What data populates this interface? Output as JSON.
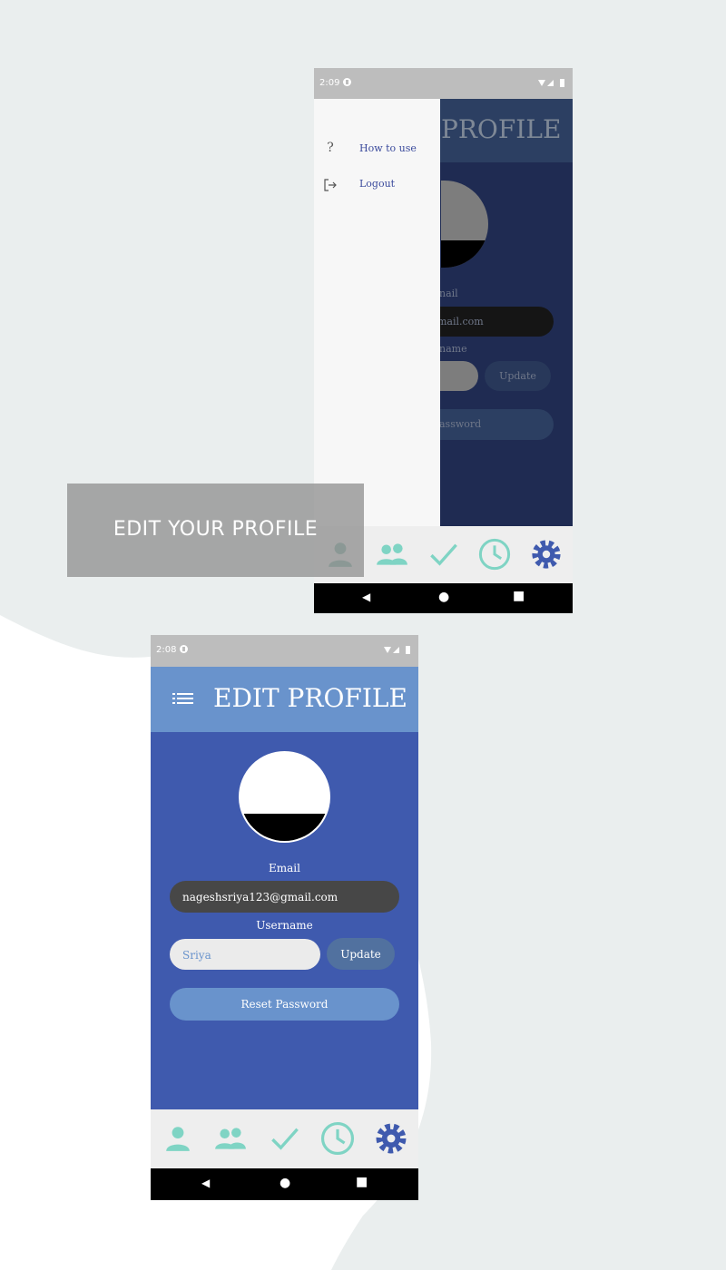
{
  "caption": "EDIT YOUR PROFILE",
  "colors": {
    "background": "#eaeeee",
    "app_bar": "#6993cc",
    "app_body": "#3f5aae",
    "email_pill": "#474747",
    "update_button": "#51719f",
    "reset_button": "#6993cc",
    "nav_icon_teal": "#7fd4c4",
    "nav_icon_active": "#3f5aae"
  },
  "screen_back": {
    "status": {
      "time": "2:09"
    },
    "title_partial": "PROFILE",
    "email_label_partial": "nail",
    "email_value_partial": "mail.com",
    "username_label_partial": "name",
    "update_label": "Update",
    "reset_partial": "assword",
    "drawer": {
      "items": [
        {
          "icon": "question-icon",
          "label": "How to use"
        },
        {
          "icon": "logout-icon",
          "label": "Logout"
        }
      ]
    }
  },
  "screen_front": {
    "status": {
      "time": "2:08"
    },
    "menu_icon": "list-menu-icon",
    "title": "EDIT PROFILE",
    "email_label": "Email",
    "email_value": "nageshsriya123@gmail.com",
    "username_label": "Username",
    "username_value": "Sriya",
    "update_label": "Update",
    "reset_label": "Reset Password"
  },
  "bottom_nav": [
    {
      "icon": "person-icon"
    },
    {
      "icon": "group-icon"
    },
    {
      "icon": "check-icon"
    },
    {
      "icon": "clock-icon"
    },
    {
      "icon": "gear-icon",
      "active": true
    }
  ]
}
